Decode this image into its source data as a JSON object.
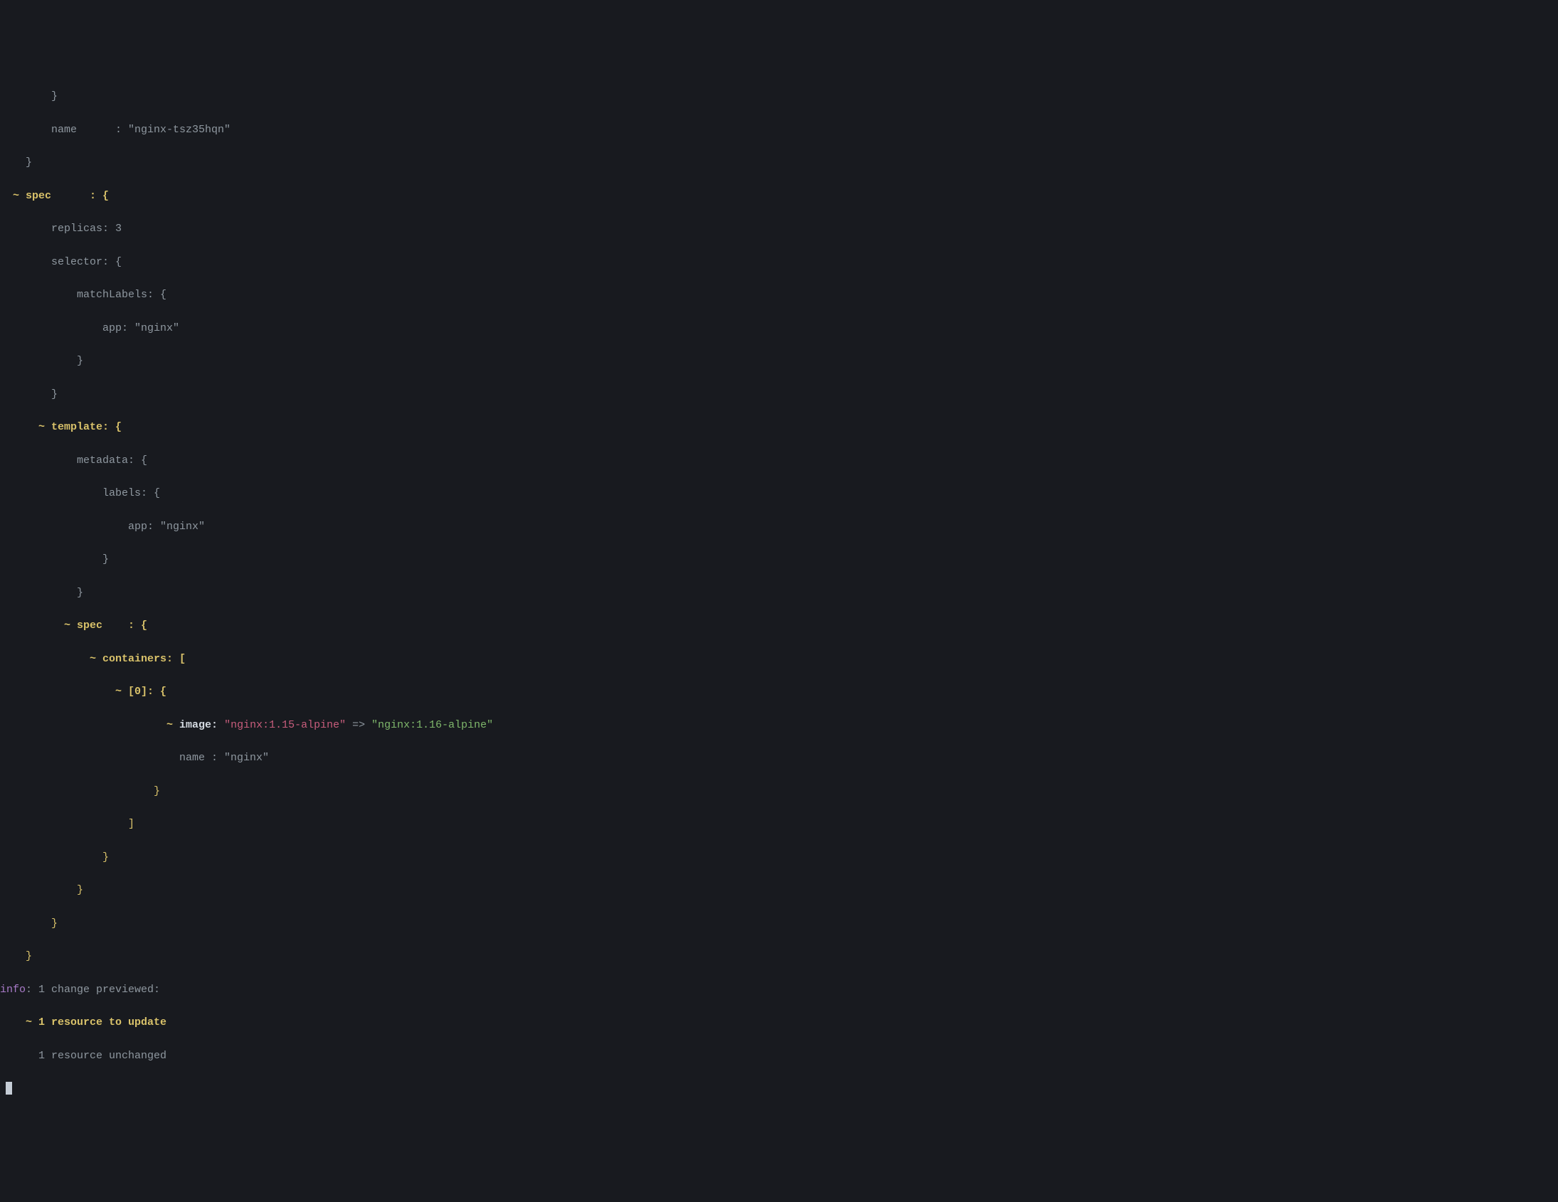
{
  "lines": {
    "l0": "        }",
    "l1a": "        name      : ",
    "l1b": "\"nginx-tsz35hqn\"",
    "l2": "    }",
    "l3a": "  ~ ",
    "l3b": "spec      : {",
    "l4": "        replicas: 3",
    "l5": "        selector: {",
    "l6": "            matchLabels: {",
    "l7": "                app: \"nginx\"",
    "l8": "            }",
    "l9": "        }",
    "l10a": "      ~ ",
    "l10b": "template: {",
    "l11": "            metadata: {",
    "l12": "                labels: {",
    "l13": "                    app: \"nginx\"",
    "l14": "                }",
    "l15": "            }",
    "l16a": "          ~ ",
    "l16b": "spec    : {",
    "l17a": "              ~ ",
    "l17b": "containers: [",
    "l18a": "                  ~ ",
    "l18b": "[0]: {",
    "l19a": "                          ~ ",
    "l19b": "image: ",
    "l19c": "\"nginx:1.15-alpine\"",
    "l19d": " => ",
    "l19e": "\"nginx:1.16-alpine\"",
    "l20": "                            name : \"nginx\"",
    "l21": "                        }",
    "l22": "                    ]",
    "l23": "                }",
    "l24": "            }",
    "l25": "        }",
    "l26": "    }",
    "l27a": "info",
    "l27b": ": 1 change previewed:",
    "l28a": "    ~ ",
    "l28b": "1 resource to update",
    "l29": "      1 resource unchanged"
  }
}
